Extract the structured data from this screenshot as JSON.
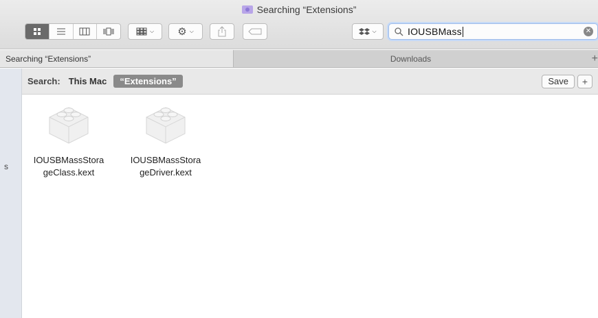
{
  "window": {
    "title": "Searching “Extensions”"
  },
  "toolbar": {
    "view_modes": [
      "icon",
      "list",
      "column",
      "cover-flow"
    ],
    "active_view": "icon",
    "search_query": "IOUSBMass"
  },
  "tabs": [
    {
      "label": "Searching “Extensions”",
      "active": true
    },
    {
      "label": "Downloads",
      "active": false
    }
  ],
  "tab_add_label": "+",
  "sidebar": {
    "glyph": "s"
  },
  "scope": {
    "label": "Search:",
    "this_mac": "This Mac",
    "folder": "“Extensions”",
    "save": "Save",
    "add": "+"
  },
  "files": [
    {
      "name": "IOUSBMassStorageClass.kext",
      "line1": "IOUSBMassStora",
      "line2": "geClass.kext",
      "icon": "kext-lego-icon"
    },
    {
      "name": "IOUSBMassStorageDriver.kext",
      "line1": "IOUSBMassStora",
      "line2": "geDriver.kext",
      "icon": "kext-lego-icon"
    }
  ],
  "colors": {
    "accent": "#9dbbea",
    "active_segment": "#6a6a6a",
    "scope_pill": "#8a8a8a"
  }
}
